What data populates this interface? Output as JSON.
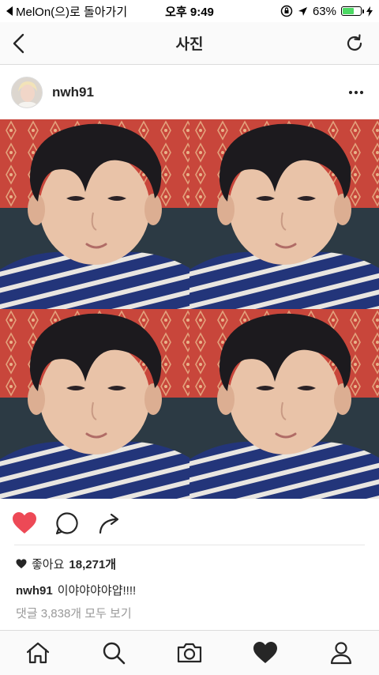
{
  "status_bar": {
    "back_app": "MelOn(으)로 돌아가기",
    "time": "오후 9:49",
    "battery": "63%",
    "battery_level": 0.63
  },
  "nav": {
    "title": "사진",
    "back_icon": "chevron-left-icon",
    "refresh_icon": "refresh-icon"
  },
  "post": {
    "username": "nwh91",
    "more_icon": "more-horizontal-icon",
    "image_icon": "photo-grid",
    "liked": true,
    "likes_label": "좋아요",
    "likes_count": "18,271개",
    "caption_user": "nwh91",
    "caption_text": "이야야야야얍!!!!",
    "comments_link": "댓글 3,838개 모두 보기"
  },
  "tab_bar": {
    "items": [
      "home-icon",
      "search-icon",
      "camera-icon",
      "heart-icon",
      "profile-icon"
    ]
  },
  "colors": {
    "like_red": "#ed4956",
    "battery_green": "#4cd964",
    "text": "#262626",
    "muted": "#999999"
  }
}
